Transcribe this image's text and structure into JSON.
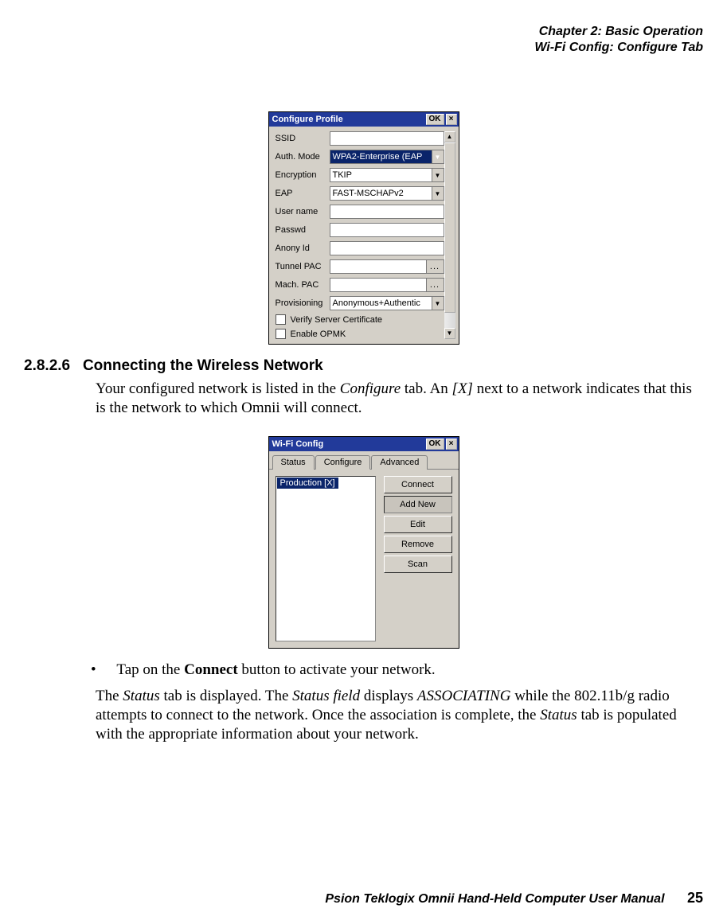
{
  "header": {
    "line1": "Chapter 2: Basic Operation",
    "line2": "Wi-Fi Config: Configure Tab"
  },
  "fig1": {
    "title": "Configure Profile",
    "ok": "OK",
    "close": "×",
    "labels": {
      "ssid": "SSID",
      "auth": "Auth. Mode",
      "enc": "Encryption",
      "eap": "EAP",
      "user": "User name",
      "pass": "Passwd",
      "anon": "Anony Id",
      "tpac": "Tunnel PAC",
      "mpac": "Mach. PAC",
      "prov": "Provisioning"
    },
    "values": {
      "ssid": "",
      "auth": "WPA2-Enterprise (EAP",
      "enc": "TKIP",
      "eap": "FAST-MSCHAPv2",
      "user": "",
      "pass": "",
      "anon": "",
      "tpac": "",
      "mpac": "",
      "prov": "Anonymous+Authentic"
    },
    "ellipsis": "...",
    "chk1": "Verify Server Certificate",
    "chk2": "Enable OPMK"
  },
  "section": {
    "number": "2.8.2.6",
    "title": "Connecting the Wireless Network"
  },
  "para1_a": "Your configured network is listed in the ",
  "para1_i1": "Configure",
  "para1_b": " tab. An ",
  "para1_i2": "[X]",
  "para1_c": " next to a network indicates that this is the network to which Omnii will connect.",
  "fig2": {
    "title": "Wi-Fi Config",
    "ok": "OK",
    "close": "×",
    "tabs": {
      "status": "Status",
      "configure": "Configure",
      "advanced": "Advanced"
    },
    "list_item": "Production [X]",
    "buttons": {
      "connect": "Connect",
      "addnew": "Add New",
      "edit": "Edit",
      "remove": "Remove",
      "scan": "Scan"
    }
  },
  "bullet_a": "Tap on the ",
  "bullet_b": "Connect",
  "bullet_c": " button to activate your network.",
  "para2_a": "The ",
  "para2_i1": "Status",
  "para2_b": " tab is displayed. The ",
  "para2_i2": "Status field",
  "para2_c": " displays ",
  "para2_i3": "ASSOCIATING",
  "para2_d": " while the 802.11b/g radio attempts to connect to the network. Once the association is complete, the ",
  "para2_i4": "Status",
  "para2_e": " tab is populated with the appropriate information about your network.",
  "footer": {
    "text": "Psion Teklogix Omnii Hand-Held Computer User Manual",
    "page": "25"
  }
}
